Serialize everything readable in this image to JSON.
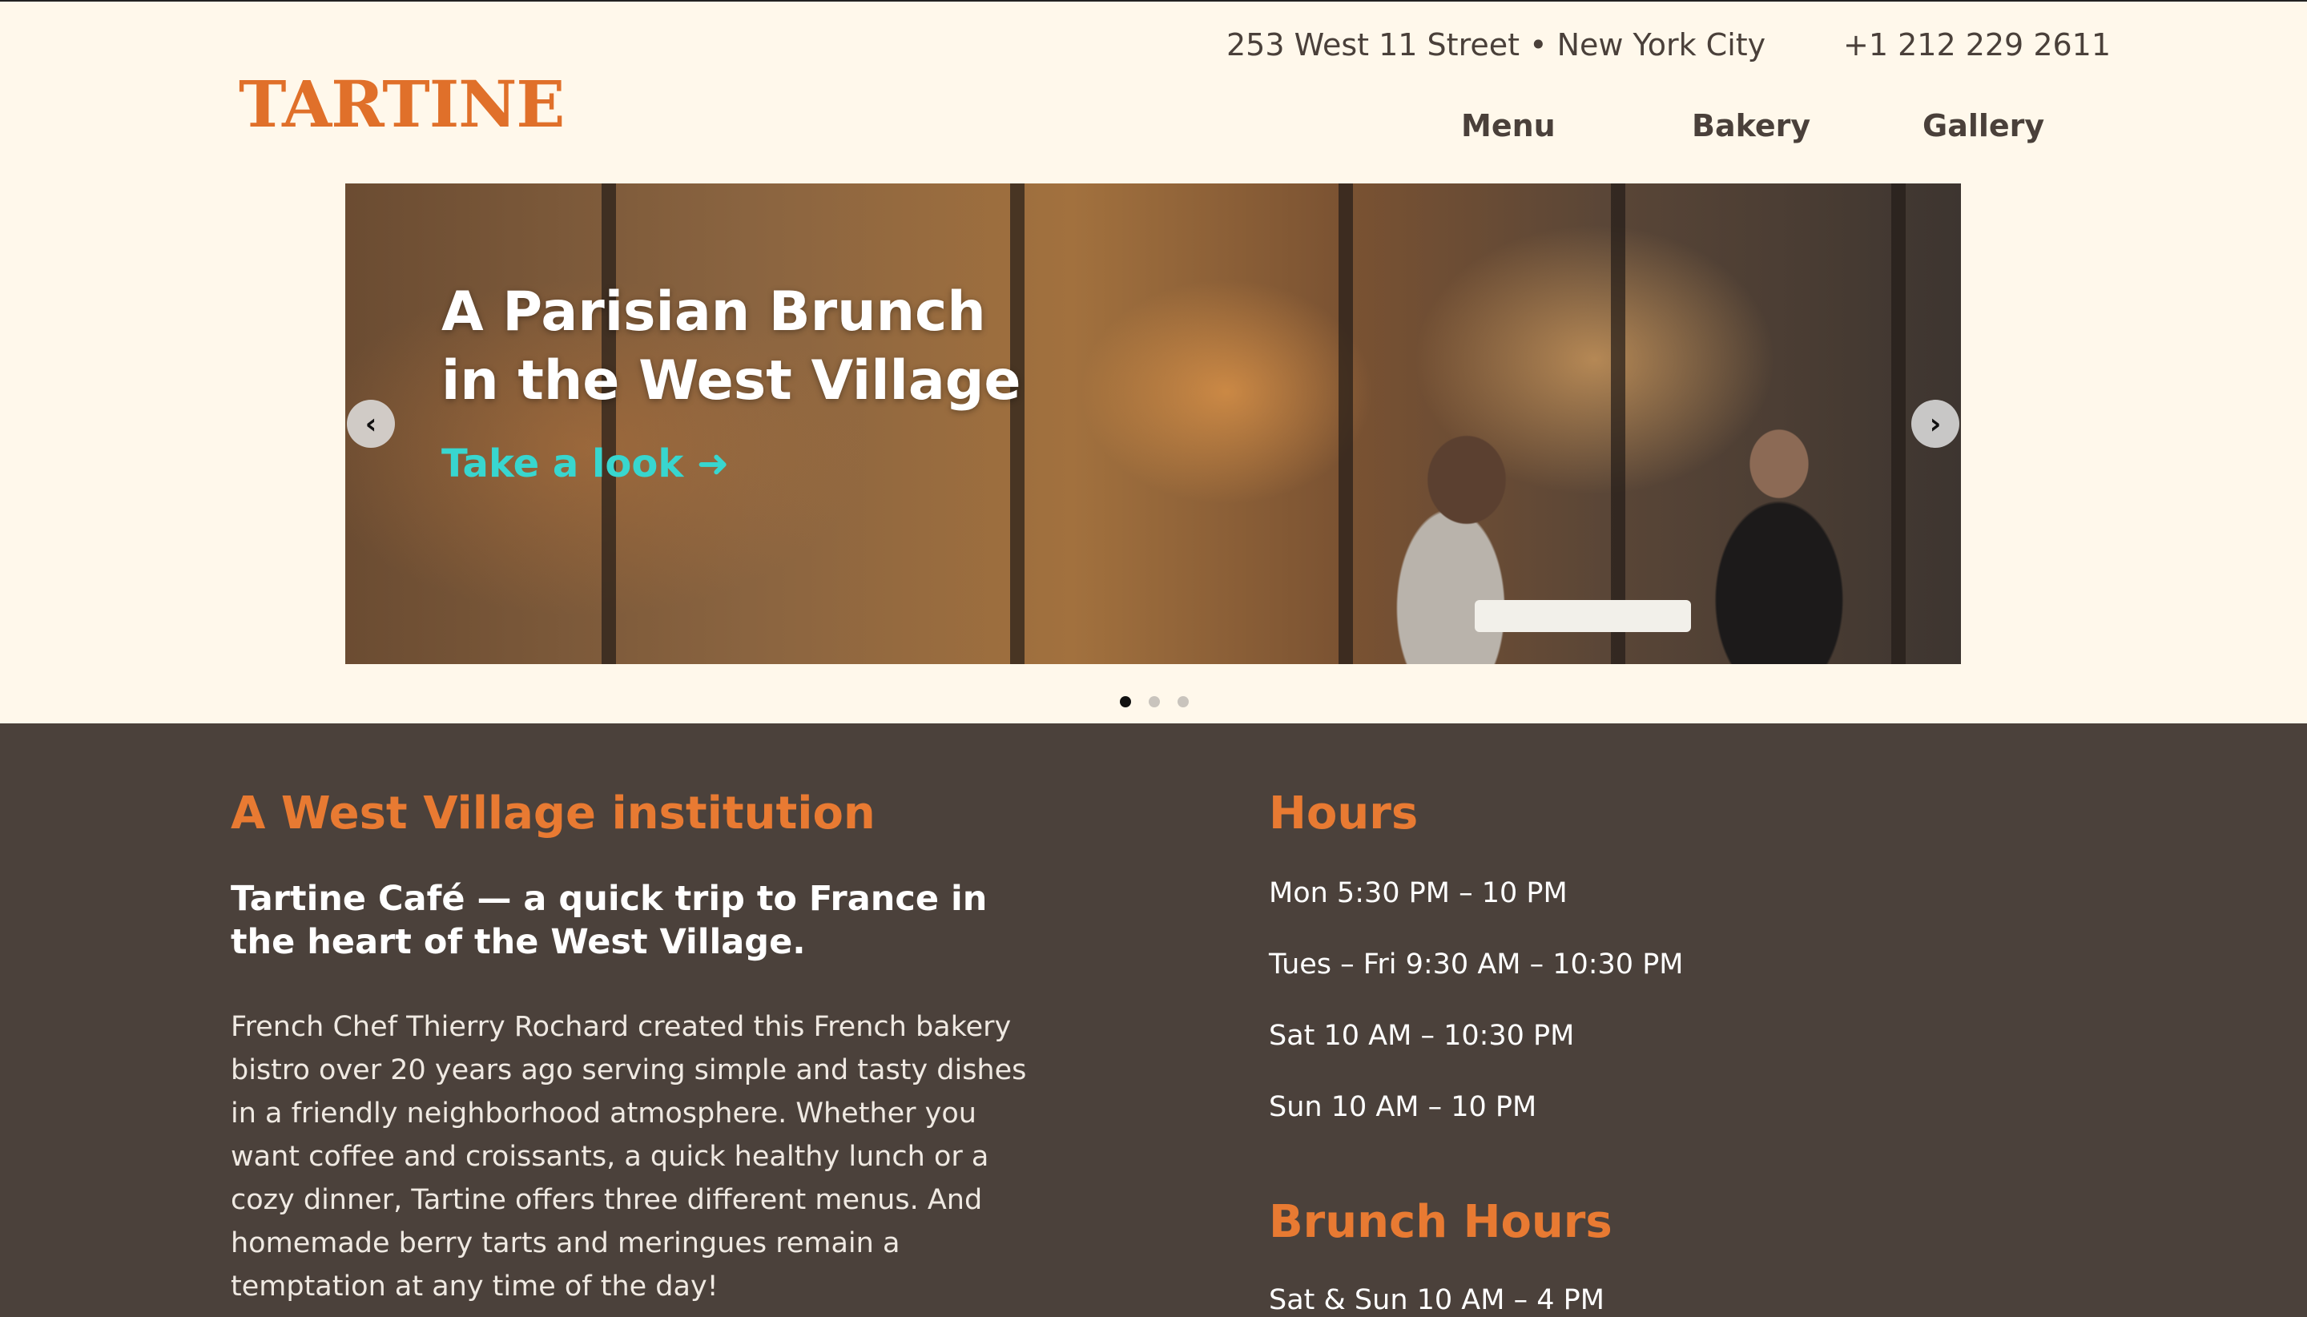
{
  "header": {
    "logo_text": "TARTINE",
    "address": "253 West 11 Street • New York City",
    "phone": "+1 212 229 2611",
    "nav": [
      {
        "label": "Menu"
      },
      {
        "label": "Bakery"
      },
      {
        "label": "Gallery"
      }
    ]
  },
  "hero": {
    "title_line1": "A Parisian Brunch",
    "title_line2": "in the West Village",
    "cta_label": "Take a look ➜",
    "prev_icon": "chevron-left-icon",
    "next_icon": "chevron-right-icon",
    "prev_glyph": "‹",
    "next_glyph": "›",
    "slide_count": 3,
    "active_slide": 1
  },
  "intro": {
    "title": "A West Village institution",
    "subtitle": "Tartine Café — a quick trip to France in the heart of the West Village.",
    "body": "French Chef Thierry Rochard created this French bakery bistro over 20 years ago serving simple and tasty dishes in a friendly neighborhood atmosphere. Whether you want coffee and croissants, a quick healthy lunch or a cozy dinner, Tartine offers three different menus. And homemade berry tarts and meringues remain a temptation at any time of the day!"
  },
  "hours": {
    "title": "Hours",
    "lines": [
      "Mon 5:30 PM – 10 PM",
      "Tues – Fri 9:30 AM – 10:30 PM",
      "Sat 10 AM – 10:30 PM",
      "Sun 10 AM – 10 PM"
    ]
  },
  "brunch": {
    "title": "Brunch Hours",
    "line": "Sat & Sun 10 AM – 4 PM"
  },
  "colors": {
    "background": "#fff8eb",
    "brand_orange": "#e0702a",
    "heading_orange": "#e87a32",
    "content_bg": "#4b413b",
    "cta_teal": "#38d6cf",
    "text_dark": "#4a403a"
  }
}
